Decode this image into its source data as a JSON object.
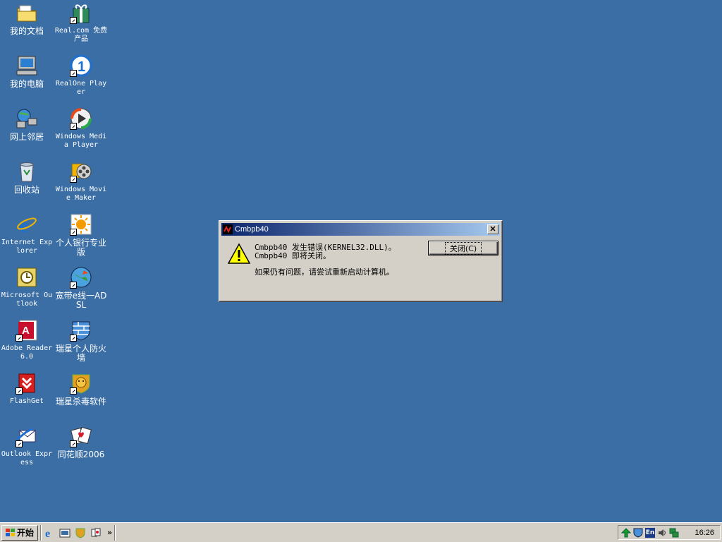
{
  "desktop_icons": [
    {
      "name": "我的文档"
    },
    {
      "name": "Real.com 免费产品"
    },
    {
      "name": "我的电脑"
    },
    {
      "name": "RealOne Player"
    },
    {
      "name": "网上邻居"
    },
    {
      "name": "Windows Media Player"
    },
    {
      "name": "回收站"
    },
    {
      "name": "Windows Movie Maker"
    },
    {
      "name": "Internet Explorer"
    },
    {
      "name": "个人银行专业版"
    },
    {
      "name": "Microsoft Outlook"
    },
    {
      "name": "宽带e线一ADSL"
    },
    {
      "name": "Adobe Reader 6.0"
    },
    {
      "name": "瑞星个人防火墙"
    },
    {
      "name": "FlashGet"
    },
    {
      "name": "瑞星杀毒软件"
    },
    {
      "name": "Outlook Express"
    },
    {
      "name": "同花顺2006"
    }
  ],
  "dialog": {
    "title": "Cmbpb40",
    "line1": "Cmbpb40 发生错误(KERNEL32.DLL)。",
    "line2": "Cmbpb40 即将关闭。",
    "line3": "如果仍有问题，请尝试重新启动计算机。",
    "close_button": "关闭(C)",
    "close_x": "✕"
  },
  "taskbar": {
    "start_label": "开始",
    "chevron": "»",
    "tray_lang": "En",
    "clock": "16:26"
  }
}
